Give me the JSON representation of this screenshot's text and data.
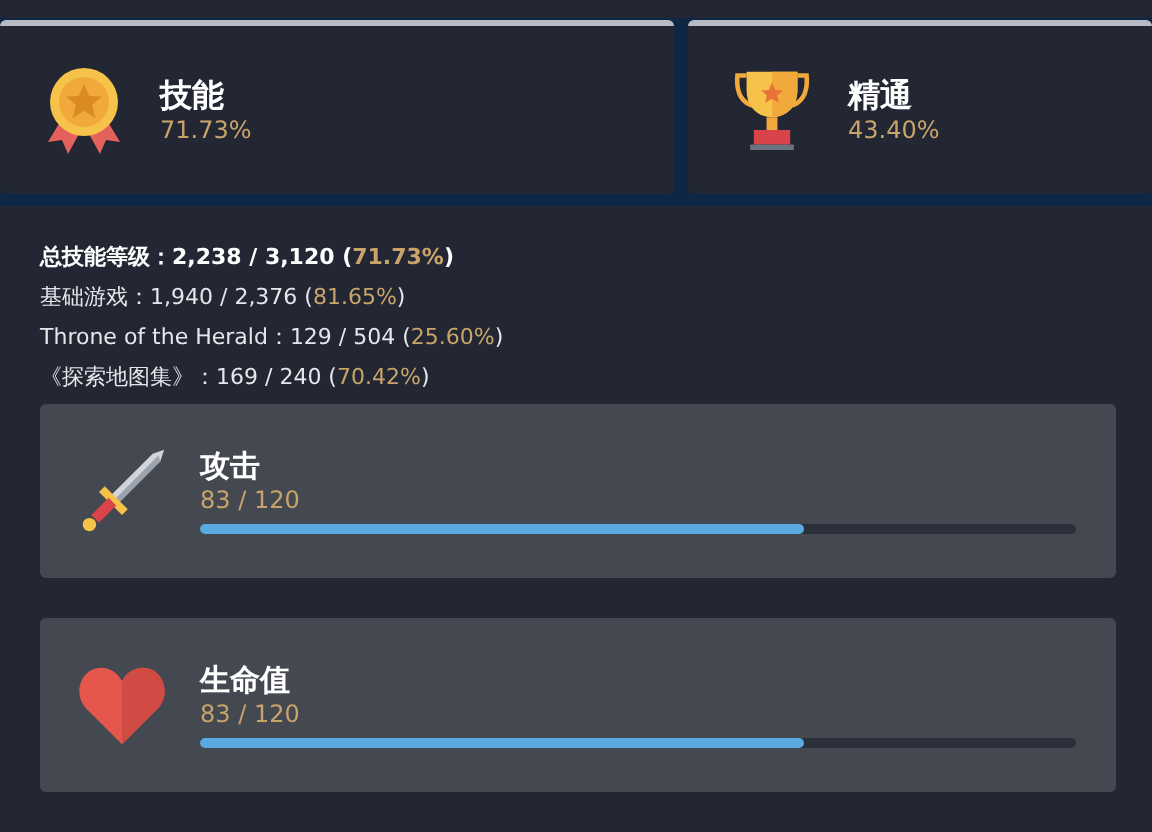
{
  "summary_cards": [
    {
      "kind": "medal",
      "title": "技能",
      "percent": "71.73%"
    },
    {
      "kind": "trophy",
      "title": "精通",
      "percent": "43.40%"
    }
  ],
  "stats": [
    {
      "bold": true,
      "label": "总技能等级：",
      "value": "2,238 / 3,120 (",
      "percent": "71.73%",
      "close": ")"
    },
    {
      "bold": false,
      "label": "基础游戏：",
      "value": "1,940 / 2,376 (",
      "percent": "81.65%",
      "close": ")"
    },
    {
      "bold": false,
      "label": "Throne of the Herald：",
      "value": "129 / 504 (",
      "percent": "25.60%",
      "close": ")"
    },
    {
      "bold": false,
      "label": "《探索地图集》：",
      "value": "169 / 240 (",
      "percent": "70.42%",
      "close": ")"
    }
  ],
  "skills": [
    {
      "kind": "sword",
      "name": "攻击",
      "value": "83 / 120",
      "level": 0.69
    },
    {
      "kind": "heart",
      "name": "生命值",
      "value": "83 / 120",
      "level": 0.69
    }
  ]
}
